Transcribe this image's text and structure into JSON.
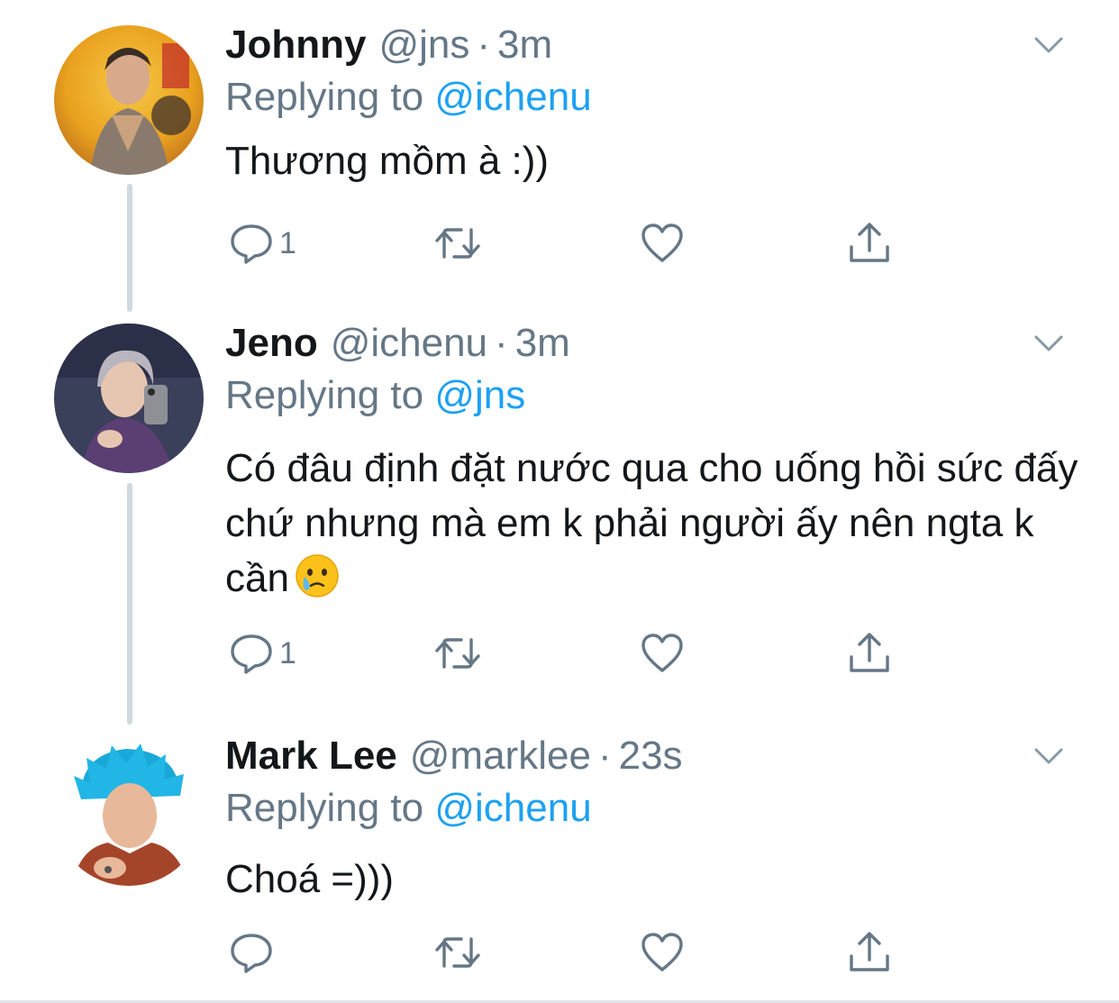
{
  "tweets": [
    {
      "name": "Johnny",
      "handle": "@jns",
      "separator": "·",
      "time": "3m",
      "replying_prefix": "Replying to ",
      "replying_to": "@ichenu",
      "text": "Thương mồm à :))",
      "reply_count": "1"
    },
    {
      "name": "Jeno",
      "handle": "@ichenu",
      "separator": "·",
      "time": "3m",
      "replying_prefix": "Replying to ",
      "replying_to": "@jns",
      "text": "Có đâu định đặt nước qua cho uống hồi sức đấy chứ nhưng mà em k phải người ấy nên ngta k cần",
      "reply_count": "1"
    },
    {
      "name": "Mark Lee",
      "handle": "@marklee",
      "separator": "·",
      "time": "23s",
      "replying_prefix": "Replying to ",
      "replying_to": "@ichenu",
      "text": "Choá =)))",
      "reply_count": ""
    }
  ],
  "icons": {
    "reply": "speech-bubble-icon",
    "retweet": "retweet-icon",
    "like": "heart-icon",
    "share": "share-icon",
    "menu": "chevron-down-icon",
    "emoji": "face-holding-back-tears-emoji"
  },
  "colors": {
    "text": "#14171a",
    "secondary": "#657786",
    "link": "#1da1f2",
    "thread_line": "#cfd9de"
  }
}
